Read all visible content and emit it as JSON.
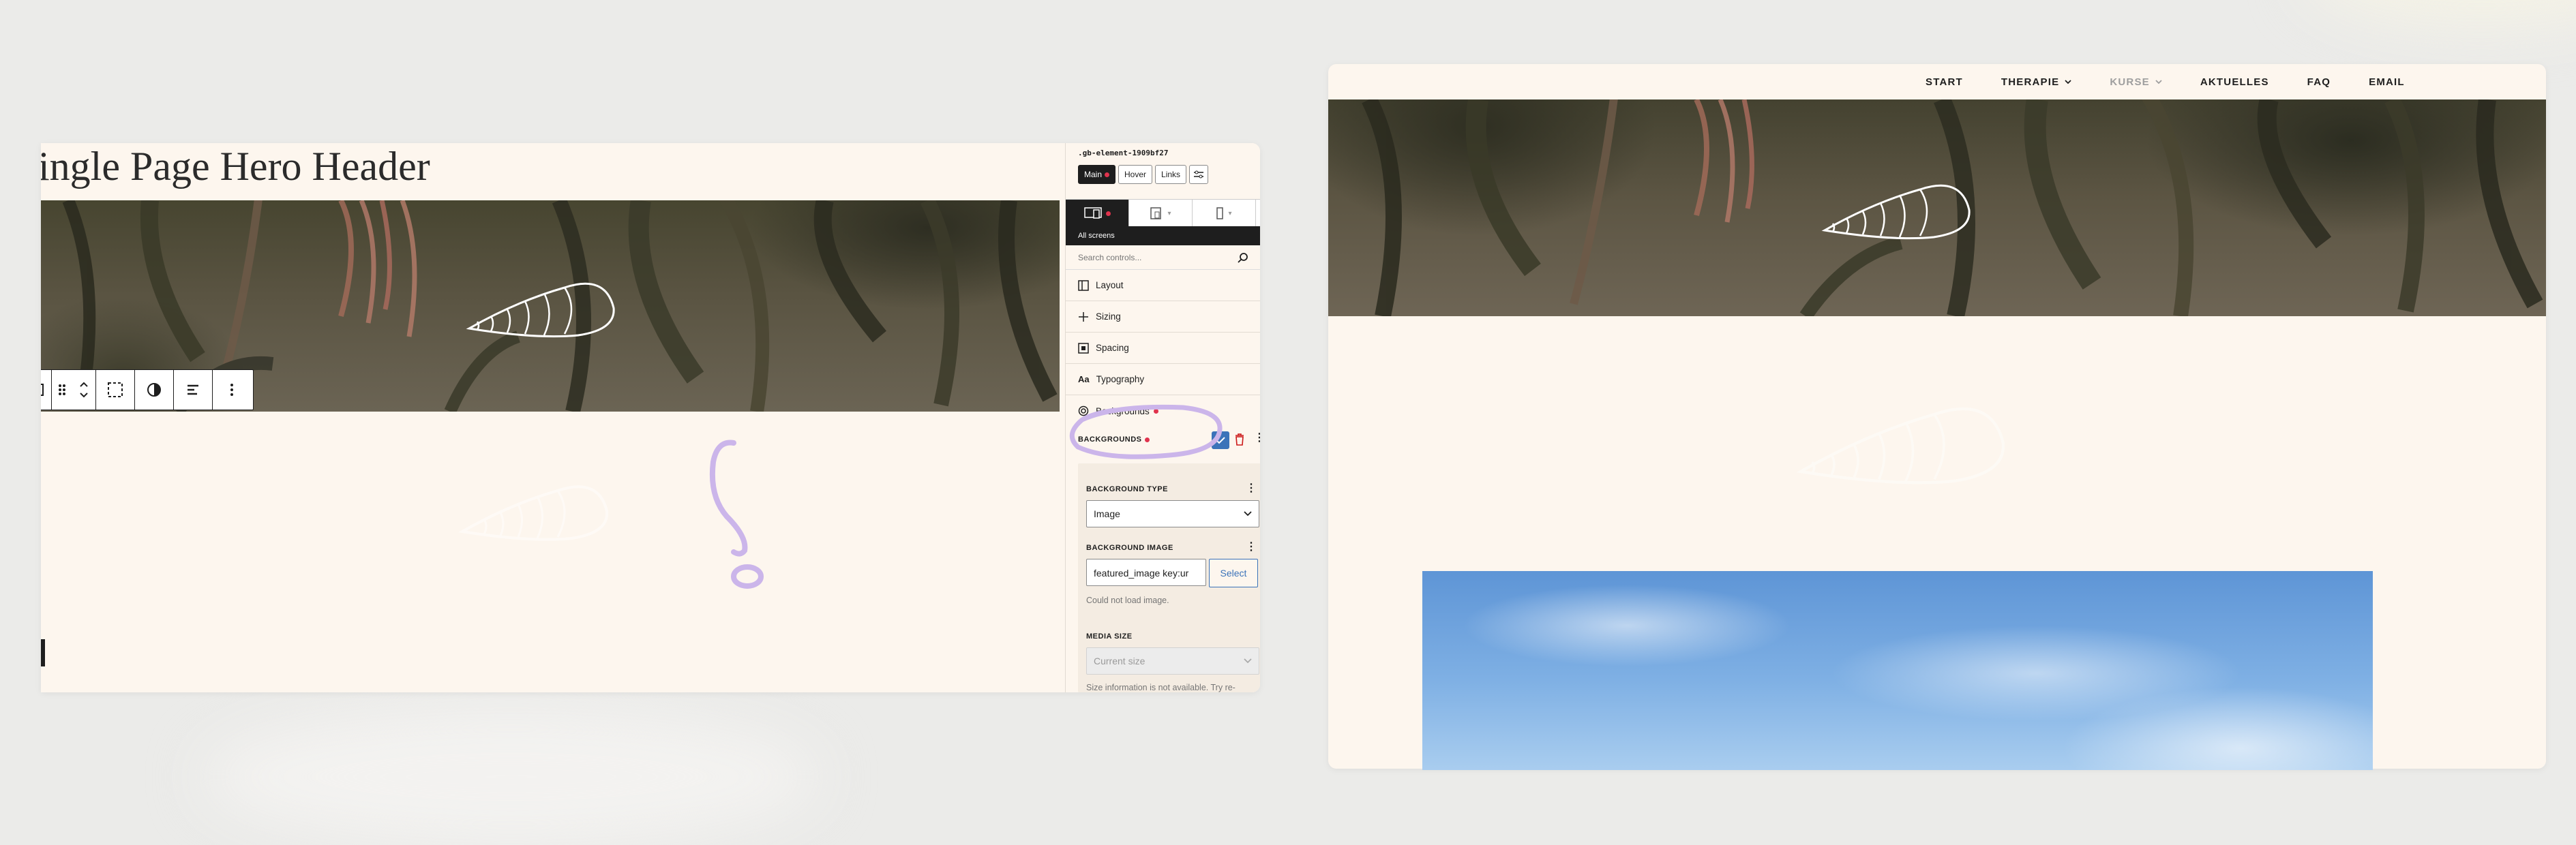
{
  "editor": {
    "page_title": "ingle Page Hero Header",
    "inspector": {
      "selector": ".gb-element-1909bf27",
      "states": [
        "Main",
        "Hover",
        "Links"
      ],
      "screens_label": "All screens",
      "search_placeholder": "Search controls...",
      "sections": [
        "Layout",
        "Sizing",
        "Spacing",
        "Typography",
        "Backgrounds"
      ],
      "backgrounds_label": "BACKGROUNDS",
      "background_type_label": "BACKGROUND TYPE",
      "background_type_value": "Image",
      "background_image_label": "BACKGROUND IMAGE",
      "background_image_value": "featured_image key:ur",
      "select_button": "Select",
      "error_text": "Could not load image.",
      "media_size_label": "MEDIA SIZE",
      "media_size_value": "Current size",
      "size_info_text": "Size information is not available. Try re-inserting the image from the Media"
    }
  },
  "preview": {
    "nav": [
      "START",
      "THERAPIE",
      "KURSE",
      "AKTUELLES",
      "FAQ",
      "EMAIL"
    ]
  },
  "colors": {
    "page_bg": "#ebebe9",
    "cream": "#fdf6ee",
    "dark": "#1e1e1e",
    "accent_blue": "#3b73b9",
    "modified_dot": "#e0334d",
    "annotation_purple": "#cbb5ea"
  }
}
